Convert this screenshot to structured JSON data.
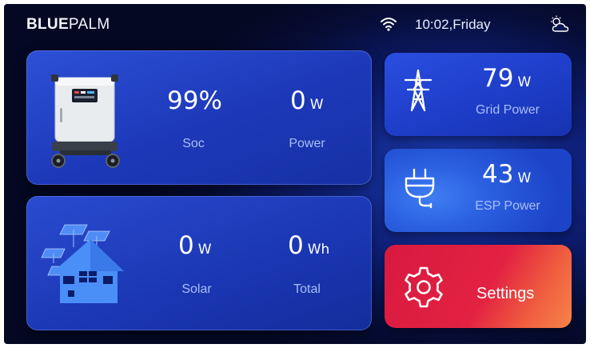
{
  "brand": {
    "bold": "BLUE",
    "light": "PALM"
  },
  "status": {
    "time": "10:02,Friday",
    "wifi_icon": "wifi-icon",
    "weather_icon": "partly-cloudy-icon"
  },
  "battery": {
    "soc_value": "99%",
    "soc_label": "Soc",
    "power_value": "0",
    "power_unit": "W",
    "power_label": "Power"
  },
  "solar": {
    "solar_value": "0",
    "solar_unit": "W",
    "solar_label": "Solar",
    "total_value": "0",
    "total_unit": "Wh",
    "total_label": "Total"
  },
  "grid": {
    "value": "79",
    "unit": "W",
    "label": "Grid Power",
    "icon": "transmission-tower-icon"
  },
  "esp": {
    "value": "43",
    "unit": "W",
    "label": "ESP Power",
    "icon": "plug-icon"
  },
  "settings": {
    "label": "Settings",
    "icon": "gear-icon"
  },
  "colors": {
    "accent": "#1c38b8",
    "label": "#a9bef5",
    "settings": "#e32242"
  }
}
